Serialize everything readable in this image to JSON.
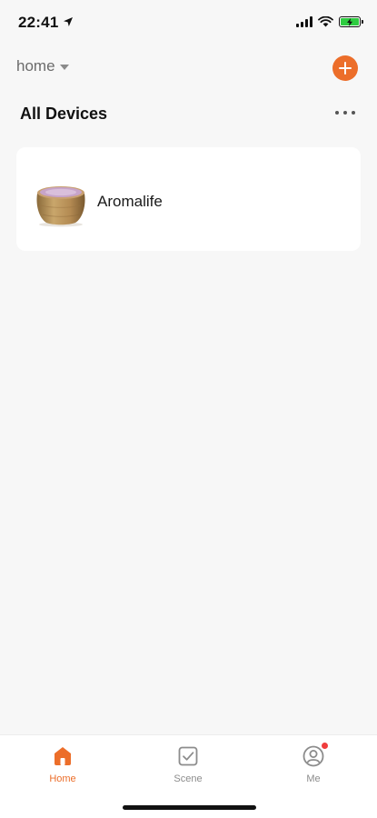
{
  "status_bar": {
    "time": "22:41",
    "icons": [
      "location-arrow-icon",
      "cellular-signal-icon",
      "wifi-icon",
      "battery-charging-icon"
    ]
  },
  "header": {
    "home_name": "home",
    "add_icon": "plus-icon"
  },
  "devices_section": {
    "title": "All Devices",
    "more_icon": "ellipsis-icon"
  },
  "devices": [
    {
      "name": "Aromalife",
      "image": "aroma-diffuser-image"
    }
  ],
  "tab_bar": {
    "tabs": [
      {
        "label": "Home",
        "icon": "home-icon",
        "active": true
      },
      {
        "label": "Scene",
        "icon": "checkbox-icon",
        "active": false
      },
      {
        "label": "Me",
        "icon": "user-icon",
        "active": false,
        "badge": true
      }
    ]
  },
  "colors": {
    "accent": "#ec6e2a",
    "background": "#f7f7f7",
    "card": "#ffffff",
    "badge": "#f03d3d",
    "battery": "#2ecc40"
  }
}
